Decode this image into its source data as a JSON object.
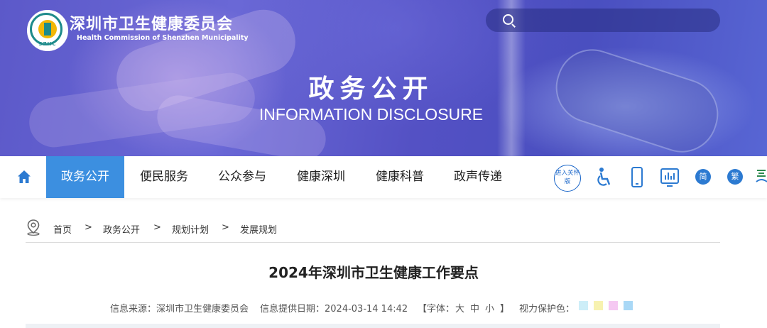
{
  "header": {
    "org_name": "深圳市卫生健康委员会",
    "org_name_en": "Health Commission of Shenzhen Municipality",
    "logo_mark": "SZHC",
    "search_placeholder": "",
    "hero_title": "政务公开",
    "hero_subtitle": "INFORMATION DISCLOSURE"
  },
  "nav": {
    "home_icon": "home-icon",
    "items": [
      {
        "label": "政务公开",
        "active": true
      },
      {
        "label": "便民服务",
        "active": false
      },
      {
        "label": "公众参与",
        "active": false
      },
      {
        "label": "健康深圳",
        "active": false
      },
      {
        "label": "健康科普",
        "active": false
      },
      {
        "label": "政声传递",
        "active": false
      }
    ],
    "tools": {
      "enter_label": "进入关怀版",
      "simplified": "简",
      "traditional": "繁"
    }
  },
  "breadcrumb": {
    "items": [
      "首页",
      "政务公开",
      "规划计划",
      "发展规划"
    ],
    "separator": ">"
  },
  "article": {
    "title": "2024年深圳市卫生健康工作要点",
    "source_label": "信息来源：深圳市卫生健康委员会",
    "date_label": "信息提供日期：2024-03-14 14:42",
    "font_open": "【字体：",
    "font_large": "大",
    "font_medium": "中",
    "font_small": "小",
    "font_close": "】",
    "eye_label": "视力保护色：",
    "eye_colors": [
      "#cdeef8",
      "#f7f2b0",
      "#f5c8f2",
      "#a9d8f6"
    ]
  },
  "colors": {
    "accent": "#3c8fe0",
    "icon_blue": "#1a66c9"
  }
}
